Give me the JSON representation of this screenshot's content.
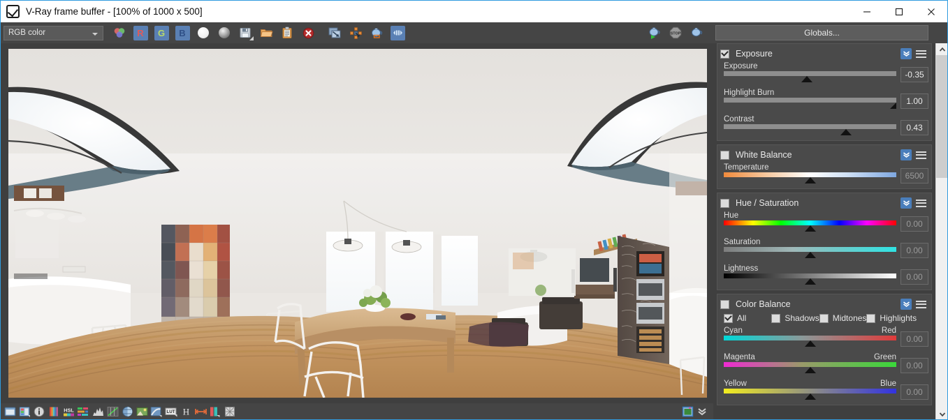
{
  "window": {
    "title": "V-Ray frame buffer - [100% of 1000 x 500]",
    "app_icon": "vray-logo-icon",
    "minimize": "minimize-icon",
    "maximize": "maximize-icon",
    "close": "close-icon"
  },
  "toolbar": {
    "channel_select": "RGB color",
    "buttons": [
      {
        "name": "color-picker-icon",
        "label": "color-picker"
      },
      {
        "name": "red-channel-button",
        "label": "R"
      },
      {
        "name": "green-channel-button",
        "label": "G"
      },
      {
        "name": "blue-channel-button",
        "label": "B"
      },
      {
        "name": "alpha-white-sphere-icon",
        "label": "white-sphere"
      },
      {
        "name": "alpha-grey-sphere-icon",
        "label": "grey-sphere"
      },
      {
        "name": "save-image-icon",
        "label": "save"
      },
      {
        "name": "open-image-icon",
        "label": "open"
      },
      {
        "name": "clipboard-icon",
        "label": "clipboard"
      },
      {
        "name": "clear-image-icon",
        "label": "clear"
      },
      {
        "name": "duplicate-window-icon",
        "label": "duplicate"
      },
      {
        "name": "track-mouse-icon",
        "label": "track"
      },
      {
        "name": "render-last-icon",
        "label": "render-last"
      },
      {
        "name": "stereo-icon",
        "label": "stereo"
      }
    ],
    "right_buttons": [
      {
        "name": "render-button-icon",
        "label": "render"
      },
      {
        "name": "stop-render-icon",
        "label": "stop"
      },
      {
        "name": "render-region-icon",
        "label": "render-region"
      }
    ],
    "globals_label": "Globals..."
  },
  "statusbar": {
    "buttons": [
      {
        "name": "show-vfb-icon"
      },
      {
        "name": "render-history-icon"
      },
      {
        "name": "pixel-info-icon"
      },
      {
        "name": "color-corrections-icon"
      },
      {
        "name": "hsl-icon",
        "label": "HSL"
      },
      {
        "name": "color-balance-icon"
      },
      {
        "name": "levels-icon"
      },
      {
        "name": "curve-icon"
      },
      {
        "name": "white-balance-icon"
      },
      {
        "name": "exposure-icon"
      },
      {
        "name": "hue-saturation-icon"
      },
      {
        "name": "lut-icon",
        "label": "LUT"
      },
      {
        "name": "ocio-icon",
        "label": "H"
      },
      {
        "name": "force-color-clamp-icon"
      },
      {
        "name": "icc-icon"
      },
      {
        "name": "background-icon"
      }
    ],
    "right_buttons": [
      {
        "name": "display-colors-icon"
      },
      {
        "name": "expand-panel-icon"
      }
    ]
  },
  "scrollbar": {
    "up_arrow": "chevron-up-icon",
    "down_arrow": "chevron-down-icon"
  },
  "panels": [
    {
      "id": "exposure",
      "title": "Exposure",
      "enabled": true,
      "collapse_icon": "chevron-double-down-icon",
      "menu_icon": "hamburger-menu-icon",
      "sliders": [
        {
          "label": "Exposure",
          "value": "-0.35",
          "pos": 48,
          "shape": "triangle",
          "grad": "plain",
          "dim": false
        },
        {
          "label": "Highlight Burn",
          "value": "1.00",
          "pos": 100,
          "shape": "corner",
          "grad": "plain",
          "dim": false
        },
        {
          "label": "Contrast",
          "value": "0.43",
          "pos": 71,
          "shape": "triangle",
          "grad": "plain",
          "dim": false
        }
      ]
    },
    {
      "id": "white_balance",
      "title": "White Balance",
      "enabled": false,
      "collapse_icon": "chevron-double-down-icon",
      "menu_icon": "hamburger-menu-icon",
      "sliders": [
        {
          "label": "Temperature",
          "value": "6500",
          "pos": 50,
          "shape": "triangle",
          "grad": "grad-temp",
          "dim": true
        }
      ]
    },
    {
      "id": "hue_saturation",
      "title": "Hue / Saturation",
      "enabled": false,
      "collapse_icon": "chevron-double-down-icon",
      "menu_icon": "hamburger-menu-icon",
      "sliders": [
        {
          "label": "Hue",
          "value": "0.00",
          "pos": 50,
          "shape": "triangle",
          "grad": "grad-hue",
          "dim": true
        },
        {
          "label": "Saturation",
          "value": "0.00",
          "pos": 50,
          "shape": "triangle",
          "grad": "grad-sat",
          "dim": true
        },
        {
          "label": "Lightness",
          "value": "0.00",
          "pos": 50,
          "shape": "triangle",
          "grad": "grad-light",
          "dim": true
        }
      ]
    },
    {
      "id": "color_balance",
      "title": "Color Balance",
      "enabled": false,
      "collapse_icon": "chevron-double-down-icon",
      "menu_icon": "hamburger-menu-icon",
      "modes": [
        {
          "label": "All",
          "checked": true
        },
        {
          "label": "Shadows",
          "checked": false
        },
        {
          "label": "Midtones",
          "checked": false
        },
        {
          "label": "Highlights",
          "checked": false
        }
      ],
      "sliders": [
        {
          "label": "Cyan",
          "label_right": "Red",
          "value": "0.00",
          "pos": 50,
          "shape": "triangle",
          "grad": "grad-cr",
          "dim": true
        },
        {
          "label": "Magenta",
          "label_right": "Green",
          "value": "0.00",
          "pos": 50,
          "shape": "triangle",
          "grad": "grad-mg",
          "dim": true
        },
        {
          "label": "Yellow",
          "label_right": "Blue",
          "value": "0.00",
          "pos": 50,
          "shape": "triangle",
          "grad": "grad-yb",
          "dim": true
        }
      ]
    }
  ],
  "render": {
    "description": "360-degree spherical panorama of a modern loft interior: white kitchen island with stools on the left, pixel-art canvas artwork, wooden dining table with white chairs and flower vase in the center, living room with dark sofas and TV, chalkboard wall with built-in ovens on the right, wooden plank floor curving across the bottom",
    "resolution": "1000 x 500",
    "zoom": "100%"
  }
}
